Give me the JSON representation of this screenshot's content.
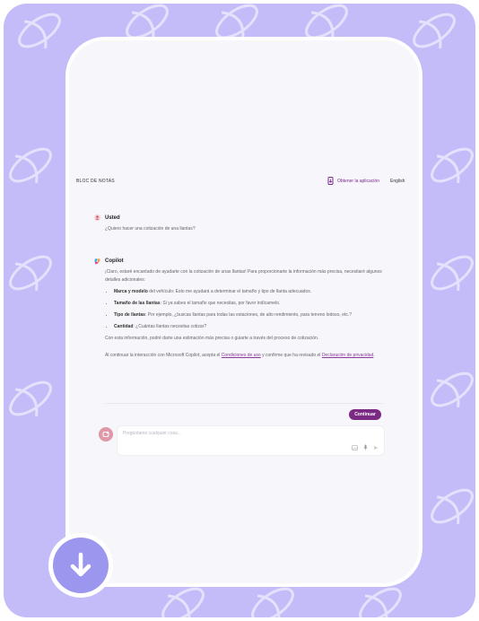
{
  "header": {
    "notes_label": "BLOC DE NOTAS",
    "get_app": "Obtener la aplicación",
    "language": "English"
  },
  "user_message": {
    "sender": "Usted",
    "text": "¿Quiero hacer una cotización de una llantas?"
  },
  "copilot_message": {
    "sender": "Copilot",
    "intro": "¡Claro, estaré encantado de ayudarte con la cotización de unas llantas! Para proporcionarte la información más precisa, necesitaré algunos detalles adicionales:",
    "items": [
      {
        "title": "Marca y modelo",
        "text": " del vehículo: Esto me ayudará a determinar el tamaño y tipo de llanta adecuados."
      },
      {
        "title": "Tamaño de las llantas",
        "text": ": Si ya sabes el tamaño que necesitas, por favor indícamelo."
      },
      {
        "title": "Tipo de llantas",
        "text": ": Por ejemplo, ¿buscas llantas para todas las estaciones, de alto rendimiento, para terreno lodoso, etc.?"
      },
      {
        "title": "Cantidad",
        "text": ": ¿Cuántas llantas necesitas cotizar?"
      }
    ],
    "outro": "Con esta información, podré darte una estimación más precisa o guiarte a través del proceso de cotización."
  },
  "terms": {
    "before": "Al continuar la interacción con Microsoft Copilot, acepta el ",
    "terms_link": "Condiciones de uso",
    "middle": " y confirme que ha revisado el ",
    "privacy_link": "Declaración de privacidad",
    "after": "."
  },
  "continue_button": "Continuar",
  "composer": {
    "placeholder": "Pregúntame cualquier cosa..."
  },
  "icons": {
    "get_app": "phone-download-icon",
    "user": "user-icon",
    "copilot": "copilot-logo-icon",
    "composer_avatar": "new-chat-icon",
    "image": "image-icon",
    "mic": "microphone-icon",
    "send": "send-icon",
    "download": "download-arrow-icon"
  },
  "colors": {
    "background": "#c3bcf8",
    "accent": "#7b2a83",
    "download": "#9b96ee"
  }
}
